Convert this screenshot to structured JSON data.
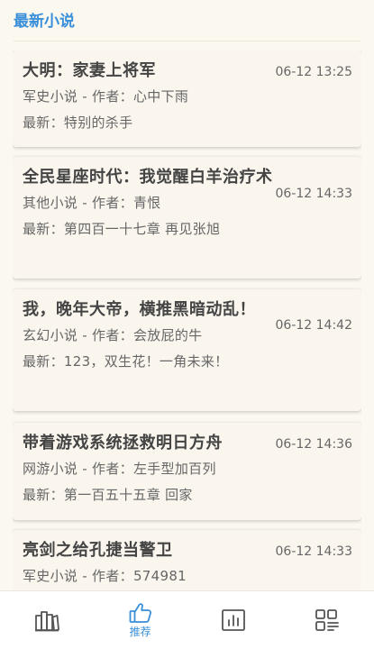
{
  "section": {
    "title": "最新小说"
  },
  "novels": [
    {
      "title": "大明：家妻上将军",
      "time": "06-12 13:25",
      "meta": "军史小说 - 作者：心中下雨",
      "latest": "最新：特别的杀手"
    },
    {
      "title": "全民星座时代：我觉醒白羊治疗术",
      "time": "06-12 14:33",
      "meta": "其他小说 - 作者：青恨",
      "latest": "最新：第四百一十七章 再见张旭"
    },
    {
      "title": "我，晚年大帝，横推黑暗动乱！",
      "time": "06-12 14:42",
      "meta": "玄幻小说 - 作者：会放屁的牛",
      "latest": "最新：123，双生花！一角未来！"
    },
    {
      "title": "带着游戏系统拯救明日方舟",
      "time": "06-12 14:36",
      "meta": "网游小说 - 作者：左手型加百列",
      "latest": "最新：第一百五十五章 回家"
    },
    {
      "title": "亮剑之给孔捷当警卫",
      "time": "06-12 14:33",
      "meta": "军史小说 - 作者：574981",
      "latest": ""
    }
  ],
  "nav": {
    "items": [
      {
        "icon": "bookshelf-icon",
        "label": ""
      },
      {
        "icon": "thumbs-up-icon",
        "label": "推荐",
        "active": true
      },
      {
        "icon": "bar-chart-icon",
        "label": ""
      },
      {
        "icon": "category-grid-icon",
        "label": ""
      }
    ]
  },
  "colors": {
    "accent": "#3a8fd8",
    "background": "#fbf8f0",
    "title_text": "#444444",
    "body_text": "#666666",
    "icon_inactive": "#555555"
  }
}
